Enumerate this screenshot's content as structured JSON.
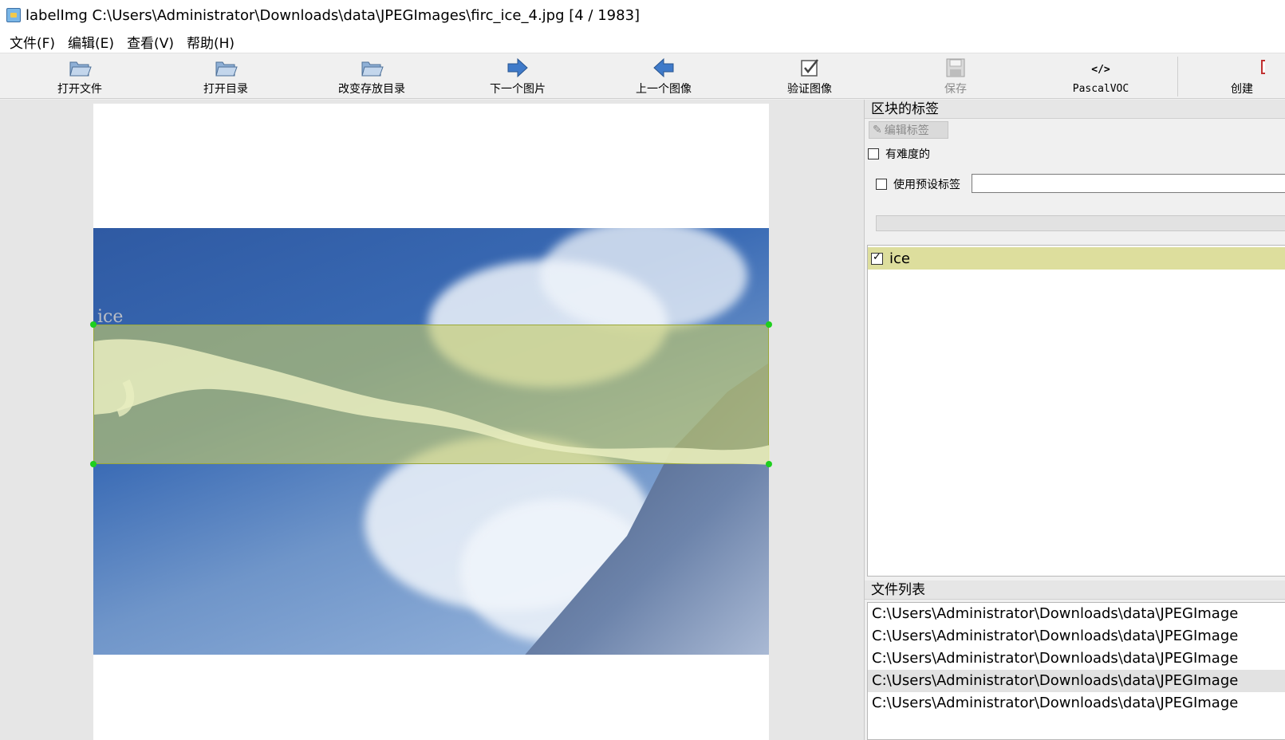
{
  "window": {
    "title": "labelImg C:\\Users\\Administrator\\Downloads\\data\\JPEGImages\\firc_ice_4.jpg [4 / 1983]"
  },
  "menu": [
    "文件(F)",
    "编辑(E)",
    "查看(V)",
    "帮助(H)"
  ],
  "toolbar": {
    "open_file": "打开文件",
    "open_dir": "打开目录",
    "change_save_dir": "改变存放目录",
    "next_image": "下一个图片",
    "prev_image": "上一个图像",
    "verify_image": "验证图像",
    "save": "保存",
    "format": "PascalVOC",
    "create": "创建"
  },
  "canvas": {
    "box_label": "ice"
  },
  "box_labels_panel": {
    "title": "区块的标签",
    "edit_label_button": "编辑标签",
    "difficult_label": "有难度的",
    "use_default_label": "使用预设标签",
    "default_label_value": "",
    "labels": [
      {
        "name": "ice",
        "checked": true
      }
    ]
  },
  "file_list_panel": {
    "title": "文件列表",
    "files": [
      {
        "path": "C:\\Users\\Administrator\\Downloads\\data\\JPEGImage",
        "selected": false
      },
      {
        "path": "C:\\Users\\Administrator\\Downloads\\data\\JPEGImage",
        "selected": false
      },
      {
        "path": "C:\\Users\\Administrator\\Downloads\\data\\JPEGImage",
        "selected": false
      },
      {
        "path": "C:\\Users\\Administrator\\Downloads\\data\\JPEGImage",
        "selected": true
      },
      {
        "path": "C:\\Users\\Administrator\\Downloads\\data\\JPEGImage",
        "selected": false
      }
    ]
  },
  "colors": {
    "label_highlight": "#ddde9d",
    "box_fill": "#c5cb67",
    "handle": "#1ecf1e"
  }
}
